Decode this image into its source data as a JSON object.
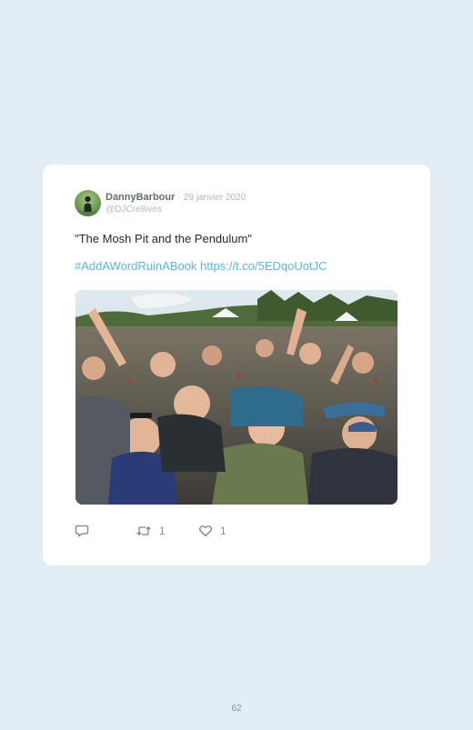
{
  "tweet": {
    "display_name": "DannyBarbour",
    "separator": "·",
    "date": "29 janvier 2020",
    "handle": "@DJCre8ives",
    "text": "\"The Mosh Pit and the Pendulum\"",
    "hashtag": "#AddAWordRuinABook",
    "link": "https://t.co/5EDqoUotJC",
    "retweet_count": "1",
    "like_count": "1"
  },
  "icons": {
    "reply": "reply-icon",
    "retweet": "retweet-icon",
    "like": "heart-icon"
  },
  "colors": {
    "background": "#e2edf5",
    "card": "#ffffff",
    "link": "#5fb4e0"
  },
  "page": {
    "number": "62"
  }
}
